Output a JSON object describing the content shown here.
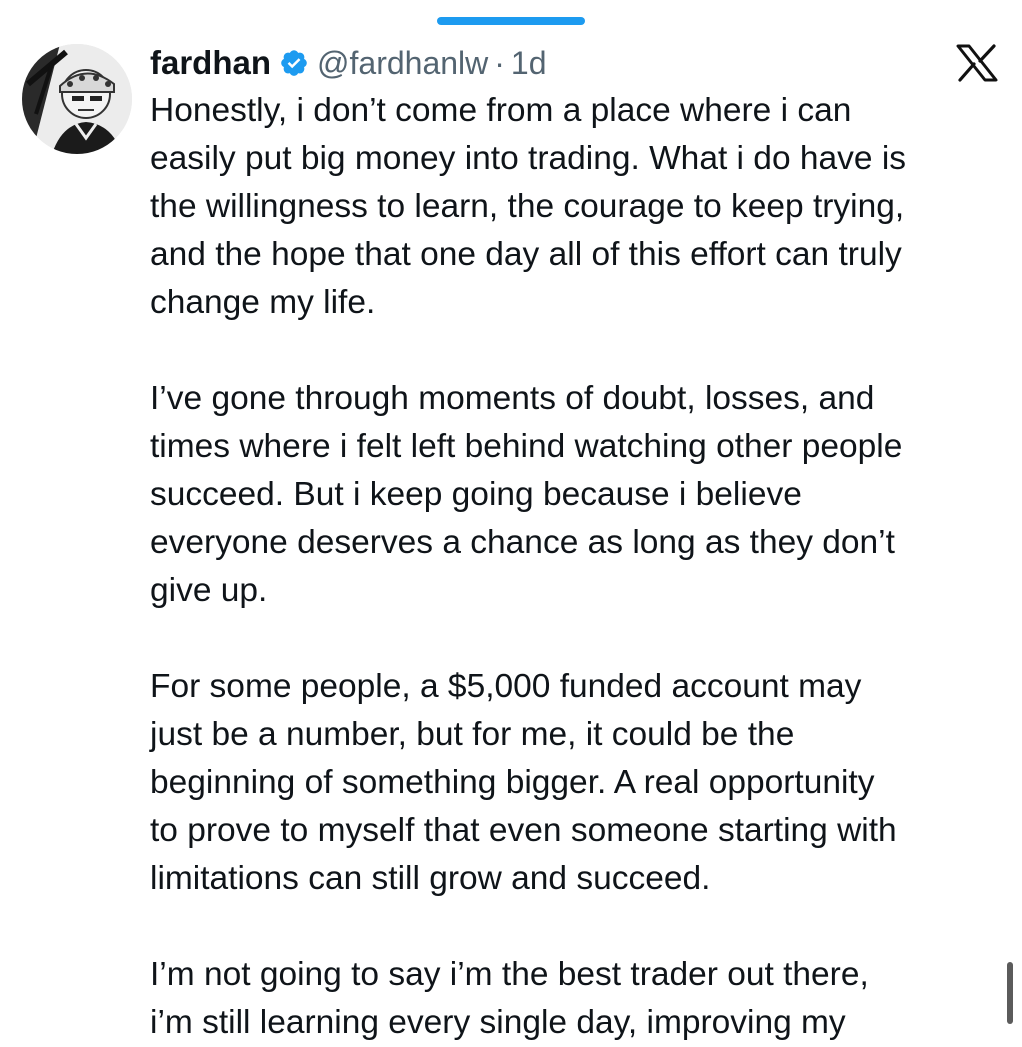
{
  "tweet": {
    "author": {
      "display_name": "fardhan",
      "verified": true,
      "handle": "@fardhanlw",
      "separator": "·",
      "time": "1d"
    },
    "paragraphs": [
      {
        "lines": [
          "Honestly, i don’t come from a place where i can",
          "easily put big money into trading. What i do have is",
          "the willingness to learn, the courage to keep trying,",
          "and the hope that one day all of this effort can truly",
          "change my life."
        ]
      },
      {
        "lines": [
          "I’ve gone through moments of doubt, losses, and",
          "times where i felt left behind watching other people",
          "succeed. But i keep going because i believe",
          "everyone deserves a chance as long as they don’t",
          "give up."
        ]
      },
      {
        "lines": [
          "For some people, a $5,000 funded account may",
          "just be a number, but for me, it could be the",
          "beginning of something bigger. A real opportunity",
          "to prove to myself that even someone starting with",
          "limitations can still grow and succeed."
        ]
      },
      {
        "lines": [
          "I’m not going to say i’m the best trader out there,",
          "i’m still learning every single day, improving my"
        ]
      }
    ]
  },
  "icons": {
    "verified": "verified-badge-icon",
    "brand": "x-logo-icon",
    "avatar": "avatar-illustration"
  },
  "colors": {
    "accent": "#1d9bf0",
    "text": "#0f1419",
    "secondary_text": "#536471",
    "background": "#ffffff"
  }
}
